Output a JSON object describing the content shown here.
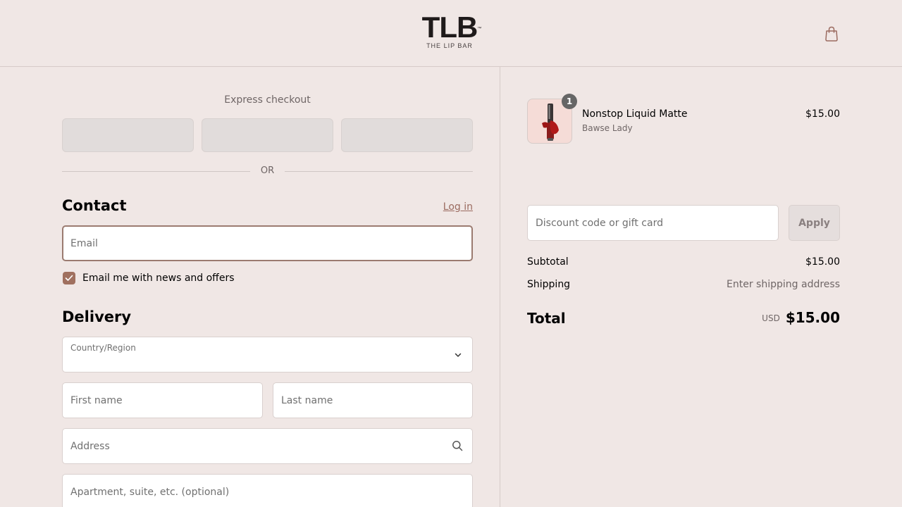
{
  "header": {
    "logo_mark": "TLB",
    "logo_tm": "™",
    "logo_sub": "THE LIP BAR",
    "cart_icon": "shopping-bag-icon"
  },
  "express": {
    "title": "Express checkout",
    "or_label": "OR"
  },
  "contact": {
    "title": "Contact",
    "login_label": "Log in",
    "email_placeholder": "Email",
    "newsletter_label": "Email me with news and offers",
    "newsletter_checked": true
  },
  "delivery": {
    "title": "Delivery",
    "country_label": "Country/Region",
    "country_value": "",
    "first_name_placeholder": "First name",
    "last_name_placeholder": "Last name",
    "address_placeholder": "Address",
    "apartment_placeholder": "Apartment, suite, etc. (optional)"
  },
  "order": {
    "item": {
      "quantity": "1",
      "name": "Nonstop Liquid Matte",
      "variant": "Bawse Lady",
      "price": "$15.00"
    },
    "discount_placeholder": "Discount code or gift card",
    "apply_label": "Apply",
    "subtotal_label": "Subtotal",
    "subtotal_value": "$15.00",
    "shipping_label": "Shipping",
    "shipping_value": "Enter shipping address",
    "total_label": "Total",
    "total_currency": "USD",
    "total_value": "$15.00"
  },
  "colors": {
    "background": "#f0e7e5",
    "accent": "#a0705f",
    "link": "#9b6b60"
  }
}
